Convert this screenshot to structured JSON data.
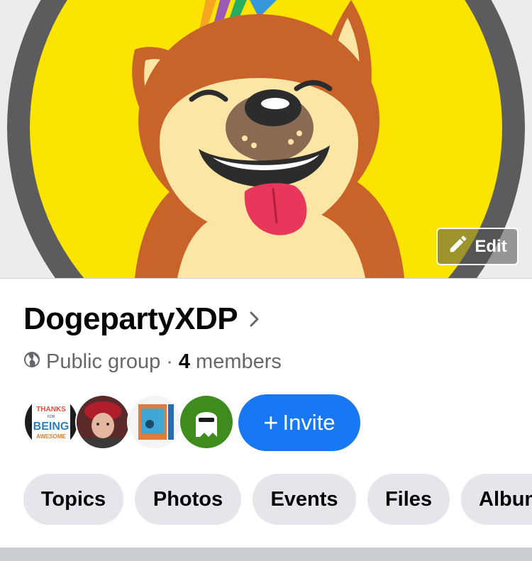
{
  "cover": {
    "edit_label": "Edit"
  },
  "group": {
    "name": "DogepartyXDP",
    "privacy": "Public group",
    "separator": "·",
    "member_count": "4",
    "member_label": "members"
  },
  "avatars": [
    {
      "name": "member-avatar-1",
      "text_lines": [
        "THANKS",
        "FOR",
        "BEING",
        "AWESOME"
      ]
    },
    {
      "name": "member-avatar-2"
    },
    {
      "name": "member-avatar-3"
    },
    {
      "name": "member-avatar-4"
    }
  ],
  "invite": {
    "plus": "+",
    "label": "Invite"
  },
  "tabs": [
    {
      "label": "Topics"
    },
    {
      "label": "Photos"
    },
    {
      "label": "Events"
    },
    {
      "label": "Files"
    },
    {
      "label": "Albums"
    }
  ],
  "colors": {
    "primary_blue": "#1877f2",
    "chip_gray": "#e4e6eb",
    "text_dark": "#050505",
    "text_muted": "#65676b",
    "cover_yellow": "#fbe400"
  },
  "icons": {
    "edit": "pencil-icon",
    "privacy": "globe-icon",
    "navigate": "chevron-right-icon"
  }
}
